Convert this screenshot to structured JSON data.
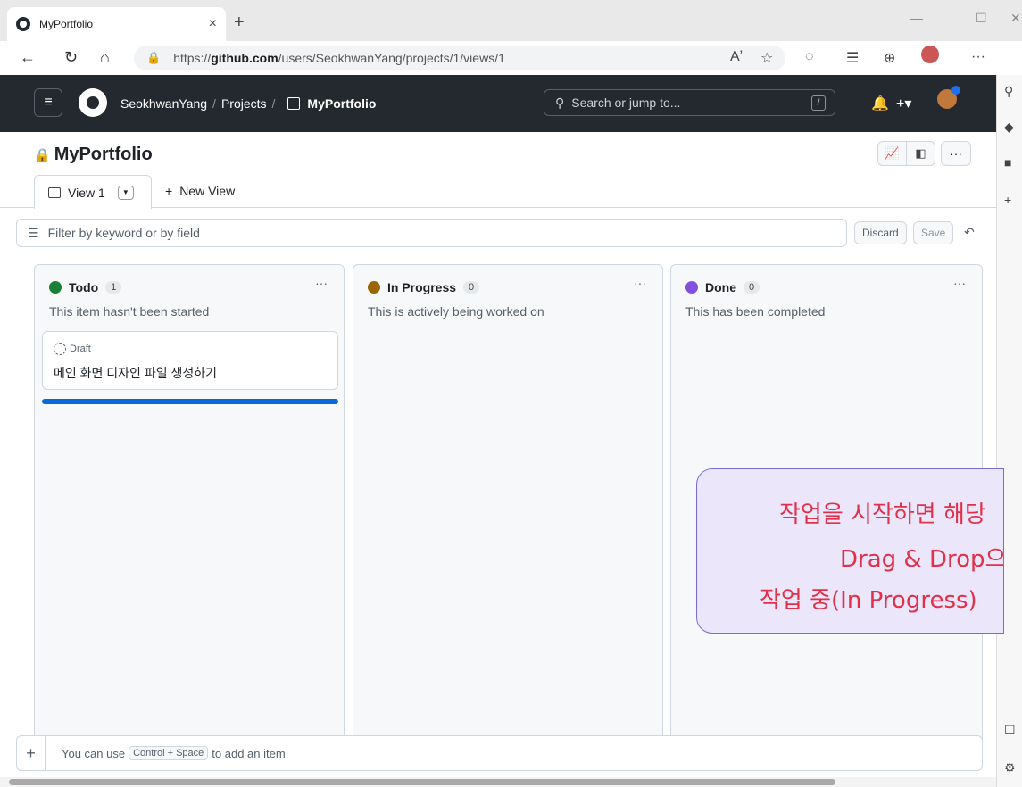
{
  "browser": {
    "tab_title": "MyPortfolio",
    "tab_close": "×",
    "new_tab": "+",
    "url_prefix": "https://",
    "url_host": "github.com",
    "url_path": "/users/SeokhwanYang/projects/1/views/1",
    "read_aloud": "A̅",
    "more": "···"
  },
  "header": {
    "user": "SeokhwanYang",
    "projects": "Projects",
    "project": "MyPortfolio",
    "search_placeholder": "Search or jump to...",
    "search_key": "/"
  },
  "project": {
    "title": "MyPortfolio",
    "more": "···",
    "view_tab": "View 1",
    "new_view": "New View",
    "filter_placeholder": "Filter by keyword or by field",
    "discard": "Discard",
    "save": "Save"
  },
  "columns": [
    {
      "name": "Todo",
      "count": "1",
      "description": "This item hasn't been started",
      "color": "#1a7f37",
      "more": "···"
    },
    {
      "name": "In Progress",
      "count": "0",
      "description": "This is actively being worked on",
      "color": "#9a6700",
      "more": "···"
    },
    {
      "name": "Done",
      "count": "0",
      "description": "This has been completed",
      "color": "#8250df",
      "more": "···"
    }
  ],
  "card": {
    "status": "Draft",
    "title": "메인 화면 디자인 파일 생성하기"
  },
  "add_item": {
    "prefix": "You can use",
    "shortcut": "Control + Space",
    "suffix": "to add an item"
  },
  "annotation": {
    "line1": "작업을 시작하면 해당",
    "line2": "Drag & Drop으",
    "line3": "작업 중(In Progress)"
  }
}
